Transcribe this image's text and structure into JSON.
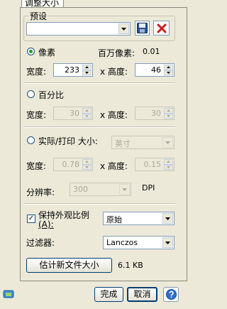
{
  "tab": {
    "label": "调整大小"
  },
  "preset": {
    "legend": "预设",
    "value": ""
  },
  "pixels": {
    "radio_label": "像素",
    "megapixel_label": "百万像素:",
    "megapixel_value": "0.01",
    "width_label": "宽度:",
    "width_value": "233",
    "height_label": "x 高度:",
    "height_value": "46"
  },
  "percent": {
    "radio_label": "百分比",
    "width_label": "宽度:",
    "width_value": "30",
    "height_label": "x 高度:",
    "height_value": "30"
  },
  "print": {
    "radio_label": "实际/打印 大小:",
    "unit_value": "英寸",
    "width_label": "宽度:",
    "width_value": "0.78",
    "height_label": "x 高度:",
    "height_value": "0.15",
    "resolution_label": "分辨率:",
    "resolution_value": "300",
    "resolution_unit": "DPI"
  },
  "keep_ratio": {
    "label": "保持外观比例",
    "label_hotkey": "(A):",
    "checked": true,
    "value": "原始"
  },
  "filter": {
    "label": "过滤器:",
    "value": "Lanczos"
  },
  "estimate": {
    "button_label": "估计新文件大小",
    "size_text": "6.1 KB"
  },
  "footer": {
    "ok_label": "完成",
    "cancel_label": "取消"
  }
}
